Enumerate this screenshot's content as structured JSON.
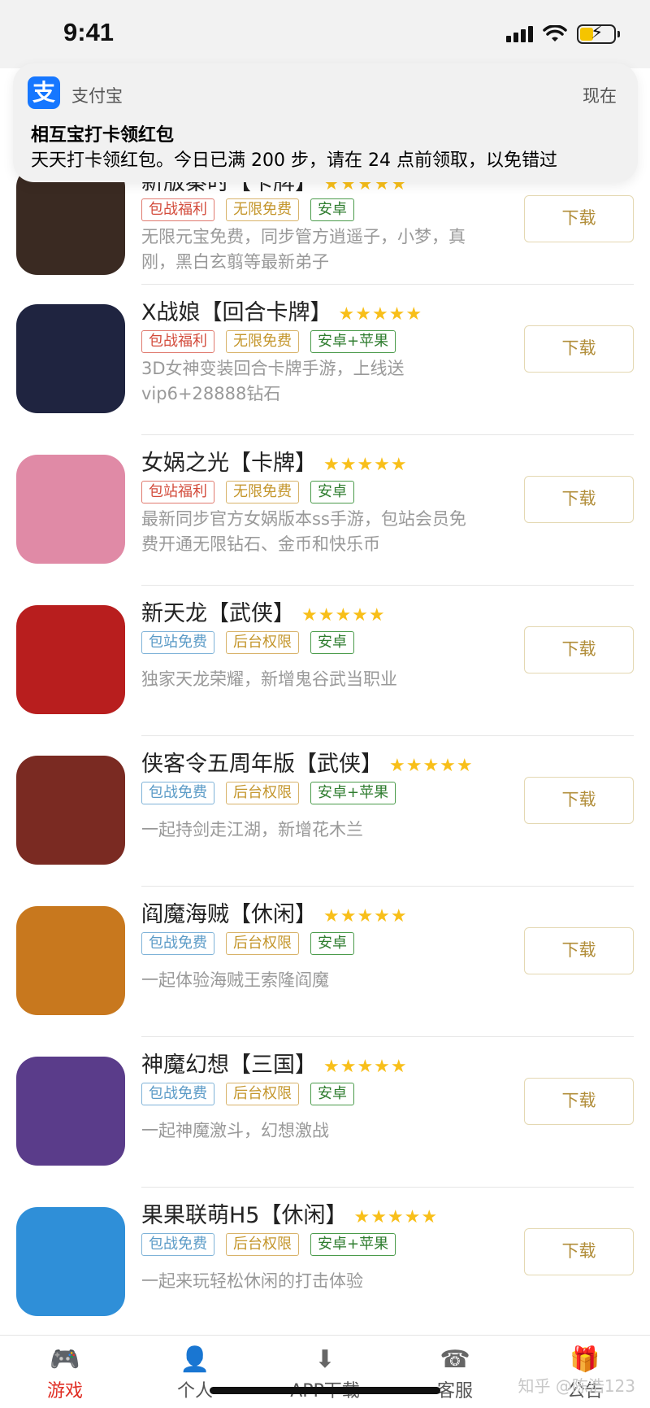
{
  "status_bar": {
    "time": "9:41"
  },
  "notification": {
    "app_name": "支付宝",
    "time": "现在",
    "title": "相互宝打卡领红包",
    "body": "天天打卡领红包。今日已满 200 步，请在 24 点前领取，以免错过"
  },
  "games": [
    {
      "name": "新版秦时【卡牌】",
      "stars": "★★★★★",
      "tags": [
        {
          "text": "包战福利",
          "color": "red"
        },
        {
          "text": "无限免费",
          "color": "orange"
        },
        {
          "text": "安卓",
          "color": "green"
        }
      ],
      "desc": "无限元宝免费，同步管方逍遥子，小梦，真刚，黑白玄翦等最新弟子",
      "download": "下载",
      "icon_bg": "#3a2a22"
    },
    {
      "name": "X战娘【回合卡牌】",
      "stars": "★★★★★",
      "tags": [
        {
          "text": "包战福利",
          "color": "red"
        },
        {
          "text": "无限免费",
          "color": "orange"
        },
        {
          "text": "安卓+苹果",
          "color": "green"
        }
      ],
      "desc": "3D女神变装回合卡牌手游，上线送vip6+28888钻石",
      "download": "下载",
      "icon_bg": "#1f2440"
    },
    {
      "name": "女娲之光【卡牌】",
      "stars": "★★★★★",
      "tags": [
        {
          "text": "包站福利",
          "color": "red"
        },
        {
          "text": "无限免费",
          "color": "orange"
        },
        {
          "text": "安卓",
          "color": "green"
        }
      ],
      "desc": "最新同步官方女娲版本ss手游，包站会员免费开通无限钻石、金币和快乐币",
      "download": "下载",
      "icon_bg": "#e08aa6"
    },
    {
      "name": "新天龙【武侠】",
      "stars": "★★★★★",
      "tags": [
        {
          "text": "包站免费",
          "color": "blue"
        },
        {
          "text": "后台权限",
          "color": "orange"
        },
        {
          "text": "安卓",
          "color": "green"
        }
      ],
      "desc": "独家天龙荣耀，新增鬼谷武当职业",
      "download": "下载",
      "icon_bg": "#b81e1e"
    },
    {
      "name": "侠客令五周年版【武侠】",
      "stars": "★★★★★",
      "tags": [
        {
          "text": "包战免费",
          "color": "blue"
        },
        {
          "text": "后台权限",
          "color": "orange"
        },
        {
          "text": "安卓+苹果",
          "color": "green"
        }
      ],
      "desc": "一起持剑走江湖，新增花木兰",
      "download": "下载",
      "icon_bg": "#7a2a22"
    },
    {
      "name": "阎魔海贼【休闲】",
      "stars": "★★★★★",
      "tags": [
        {
          "text": "包战免费",
          "color": "blue"
        },
        {
          "text": "后台权限",
          "color": "orange"
        },
        {
          "text": "安卓",
          "color": "green"
        }
      ],
      "desc": "一起体验海贼王索隆阎魔",
      "download": "下载",
      "icon_bg": "#c8781e"
    },
    {
      "name": "神魔幻想【三国】",
      "stars": "★★★★★",
      "tags": [
        {
          "text": "包战免费",
          "color": "blue"
        },
        {
          "text": "后台权限",
          "color": "orange"
        },
        {
          "text": "安卓",
          "color": "green"
        }
      ],
      "desc": "一起神魔激斗，幻想激战",
      "download": "下载",
      "icon_bg": "#5a3c8a"
    },
    {
      "name": "果果联萌H5【休闲】",
      "stars": "★★★★★",
      "tags": [
        {
          "text": "包战免费",
          "color": "blue"
        },
        {
          "text": "后台权限",
          "color": "orange"
        },
        {
          "text": "安卓+苹果",
          "color": "green"
        }
      ],
      "desc": "一起来玩轻松休闲的打击体验",
      "download": "下载",
      "icon_bg": "#2f8fd8"
    }
  ],
  "tabbar": [
    {
      "label": "游戏",
      "icon": "gamepad-icon",
      "glyph": "🎮",
      "active": true
    },
    {
      "label": "个人",
      "icon": "person-icon",
      "glyph": "👤",
      "active": false
    },
    {
      "label": "APP下载",
      "icon": "download-icon",
      "glyph": "⬇",
      "active": false
    },
    {
      "label": "客服",
      "icon": "phone-icon",
      "glyph": "☎",
      "active": false
    },
    {
      "label": "公告",
      "icon": "gift-icon",
      "glyph": "🎁",
      "active": false
    }
  ],
  "watermark": "知乎 @陈浩123"
}
